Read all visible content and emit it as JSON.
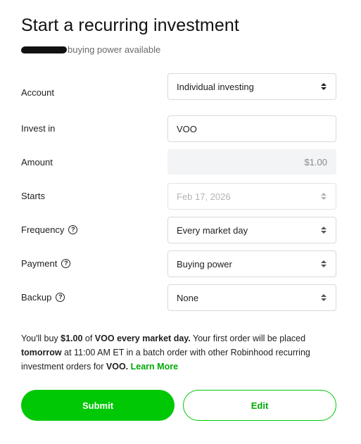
{
  "header": {
    "title": "Start a recurring investment",
    "buying_power_suffix": "buying power available"
  },
  "form": {
    "account": {
      "label": "Account",
      "value": "Individual investing"
    },
    "invest_in": {
      "label": "Invest in",
      "value": "VOO"
    },
    "amount": {
      "label": "Amount",
      "placeholder": "$1.00"
    },
    "starts": {
      "label": "Starts",
      "value": "Feb 17, 2026"
    },
    "frequency": {
      "label": "Frequency",
      "value": "Every market day"
    },
    "payment": {
      "label": "Payment",
      "value": "Buying power"
    },
    "backup": {
      "label": "Backup",
      "value": "None"
    }
  },
  "summary": {
    "t1": "You'll buy ",
    "amount": "$1.00",
    "t2": " of ",
    "ticker": "VOO",
    "t3": " ",
    "frequency": "every market day.",
    "t4": " Your first order will be placed ",
    "first_order_day": "tomorrow",
    "t5": " at 11:00 AM ET in a batch order with other Robinhood recurring investment orders for ",
    "ticker2": "VOO.",
    "t6": " ",
    "learn_more": "Learn More"
  },
  "buttons": {
    "submit": "Submit",
    "edit": "Edit"
  },
  "colors": {
    "brand_green": "#00c805",
    "link_green": "#00a805"
  },
  "icons": {
    "help": "question-circle-icon",
    "select": "up-down-arrows-icon"
  }
}
